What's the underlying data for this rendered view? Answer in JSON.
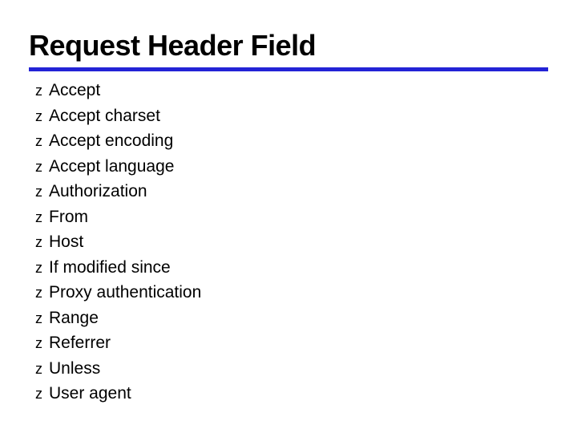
{
  "slide": {
    "title": "Request Header Field",
    "bullet_glyph": "z",
    "items": [
      "Accept",
      "Accept charset",
      "Accept encoding",
      "Accept language",
      "Authorization",
      "From",
      "Host",
      "If modified since",
      "Proxy authentication",
      "Range",
      "Referrer",
      "Unless",
      "User agent"
    ]
  }
}
